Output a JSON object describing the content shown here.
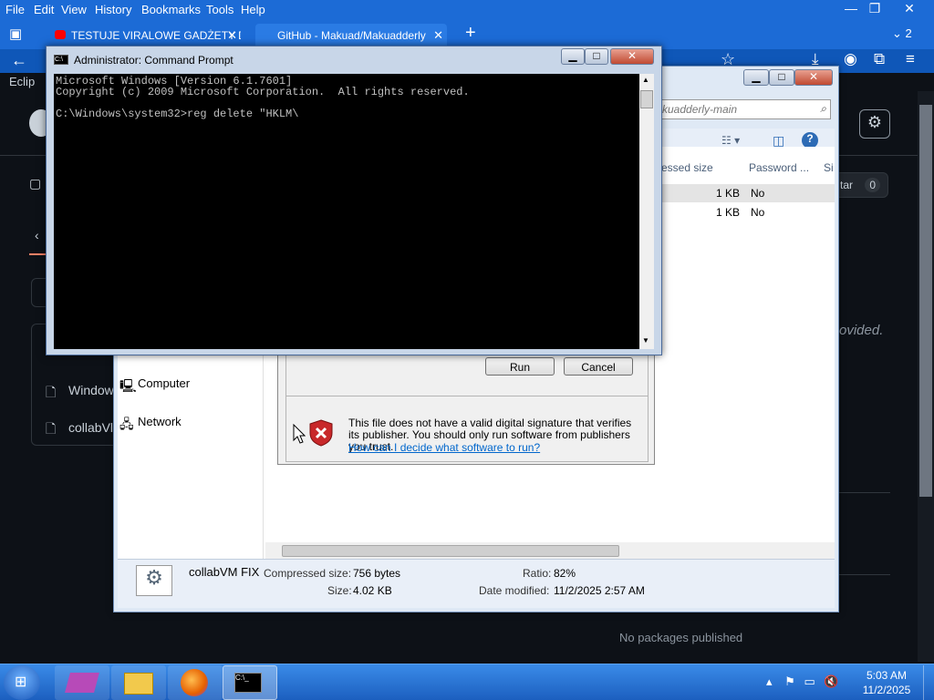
{
  "firefox": {
    "menu": [
      "File",
      "Edit",
      "View",
      "History",
      "Bookmarks",
      "Tools",
      "Help"
    ],
    "tabs": [
      {
        "label": "TESTUJE VIRALOWE GADŻETY D",
        "active": false
      },
      {
        "label": "GitHub - Makuad/Makuadderly",
        "active": true
      }
    ],
    "tab_count": "2",
    "tab_close": "✕",
    "new_tab": "+",
    "window_minimize": "—",
    "window_restore": "❐",
    "window_close": "✕"
  },
  "github": {
    "sidebar_fragment": "Eclip",
    "star_label": "tar",
    "star_count": "0",
    "provided_text": "ovided.",
    "packages": "No packages published",
    "left_items": [
      "Window",
      "collabVl"
    ]
  },
  "explorer": {
    "search_placeholder": "kuadderly-main",
    "columns": [
      "ressed size",
      "Password ...",
      "Si"
    ],
    "rows": [
      {
        "size": "1 KB",
        "password": "No"
      },
      {
        "size": "1 KB",
        "password": "No"
      }
    ],
    "nav": [
      "Computer",
      "Network"
    ],
    "details": {
      "name": "collabVM FIX",
      "compressed_label": "Compressed size:",
      "compressed_value": "756 bytes",
      "size_label": "Size:",
      "size_value": "4.02 KB",
      "ratio_label": "Ratio:",
      "ratio_value": "82%",
      "modified_label": "Date modified:",
      "modified_value": "11/2/2025 2:57 AM"
    }
  },
  "run_dialog": {
    "run": "Run",
    "cancel": "Cancel",
    "warning": "This file does not have a valid digital signature that verifies its publisher.  You should only run software from publishers you trust.",
    "link": "How can I decide what software to run?"
  },
  "cmd": {
    "title": "Administrator: Command Prompt",
    "lines": "Microsoft Windows [Version 6.1.7601]\nCopyright (c) 2009 Microsoft Corporation.  All rights reserved.\n\nC:\\Windows\\system32>reg delete \"HKLM\\"
  },
  "taskbar": {
    "time": "5:03 AM",
    "date": "11/2/2025"
  }
}
